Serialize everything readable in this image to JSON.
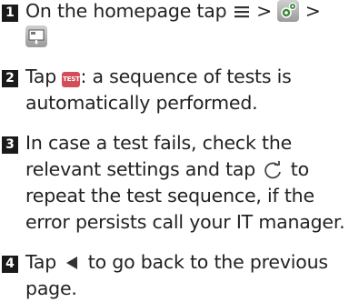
{
  "steps": [
    {
      "number": "1",
      "text_a": "On the homepage tap",
      "sep1": ">",
      "sep2": ">"
    },
    {
      "number": "2",
      "test_badge": "TEST",
      "text_a": ": a sequence of tests is",
      "text_b": "automatically performed.",
      "lead": "Tap"
    },
    {
      "number": "3",
      "line1": "In case a test fails, check the",
      "line2a": "relevant settings and tap",
      "line2b": "to",
      "line3": "repeat the test sequence, if the",
      "line4": "error persists call your IT manager."
    },
    {
      "number": "4",
      "lead": "Tap",
      "text_a": "to go back to the previous",
      "text_b": "page."
    }
  ],
  "icons": [
    "menu-icon",
    "settings-icon",
    "test-screen-icon",
    "test-badge-icon",
    "refresh-icon",
    "back-arrow-icon"
  ]
}
